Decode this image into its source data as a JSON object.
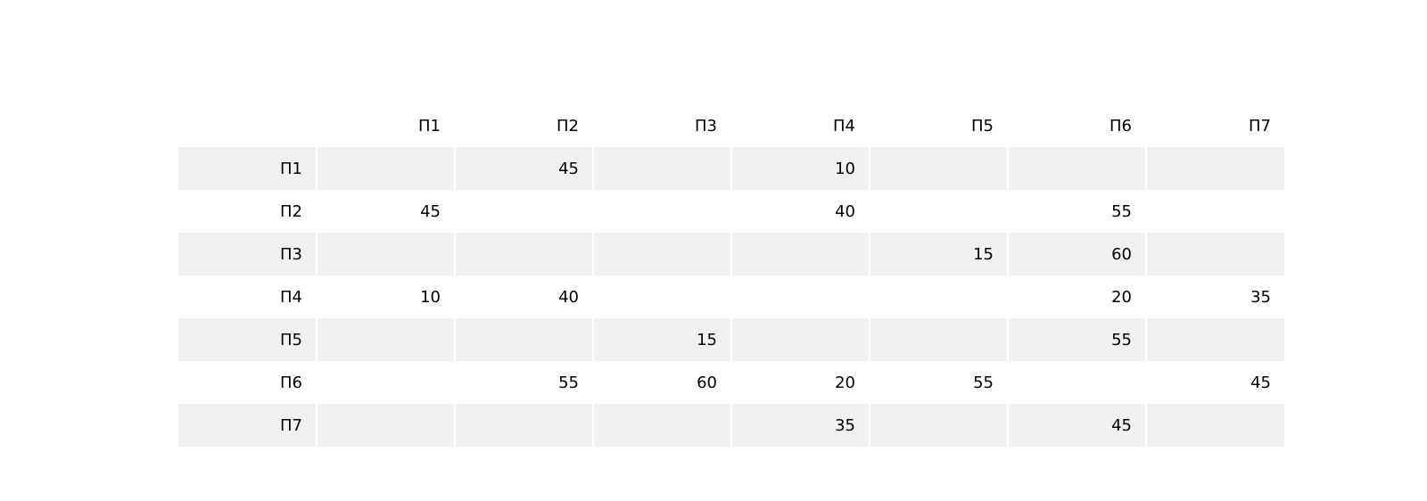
{
  "chart_data": {
    "type": "table",
    "columns": [
      "",
      "П1",
      "П2",
      "П3",
      "П4",
      "П5",
      "П6",
      "П7"
    ],
    "rows": [
      [
        "П1",
        "",
        "45",
        "",
        "10",
        "",
        "",
        ""
      ],
      [
        "П2",
        "45",
        "",
        "",
        "40",
        "",
        "55",
        ""
      ],
      [
        "П3",
        "",
        "",
        "",
        "",
        "15",
        "60",
        ""
      ],
      [
        "П4",
        "10",
        "40",
        "",
        "",
        "",
        "20",
        "35"
      ],
      [
        "П5",
        "",
        "",
        "15",
        "",
        "",
        "55",
        ""
      ],
      [
        "П6",
        "",
        "55",
        "60",
        "20",
        "55",
        "",
        "45"
      ],
      [
        "П7",
        "",
        "",
        "",
        "35",
        "",
        "45",
        ""
      ]
    ],
    "stripe_color": "#f1f1f1",
    "background_color": "#ffffff"
  }
}
